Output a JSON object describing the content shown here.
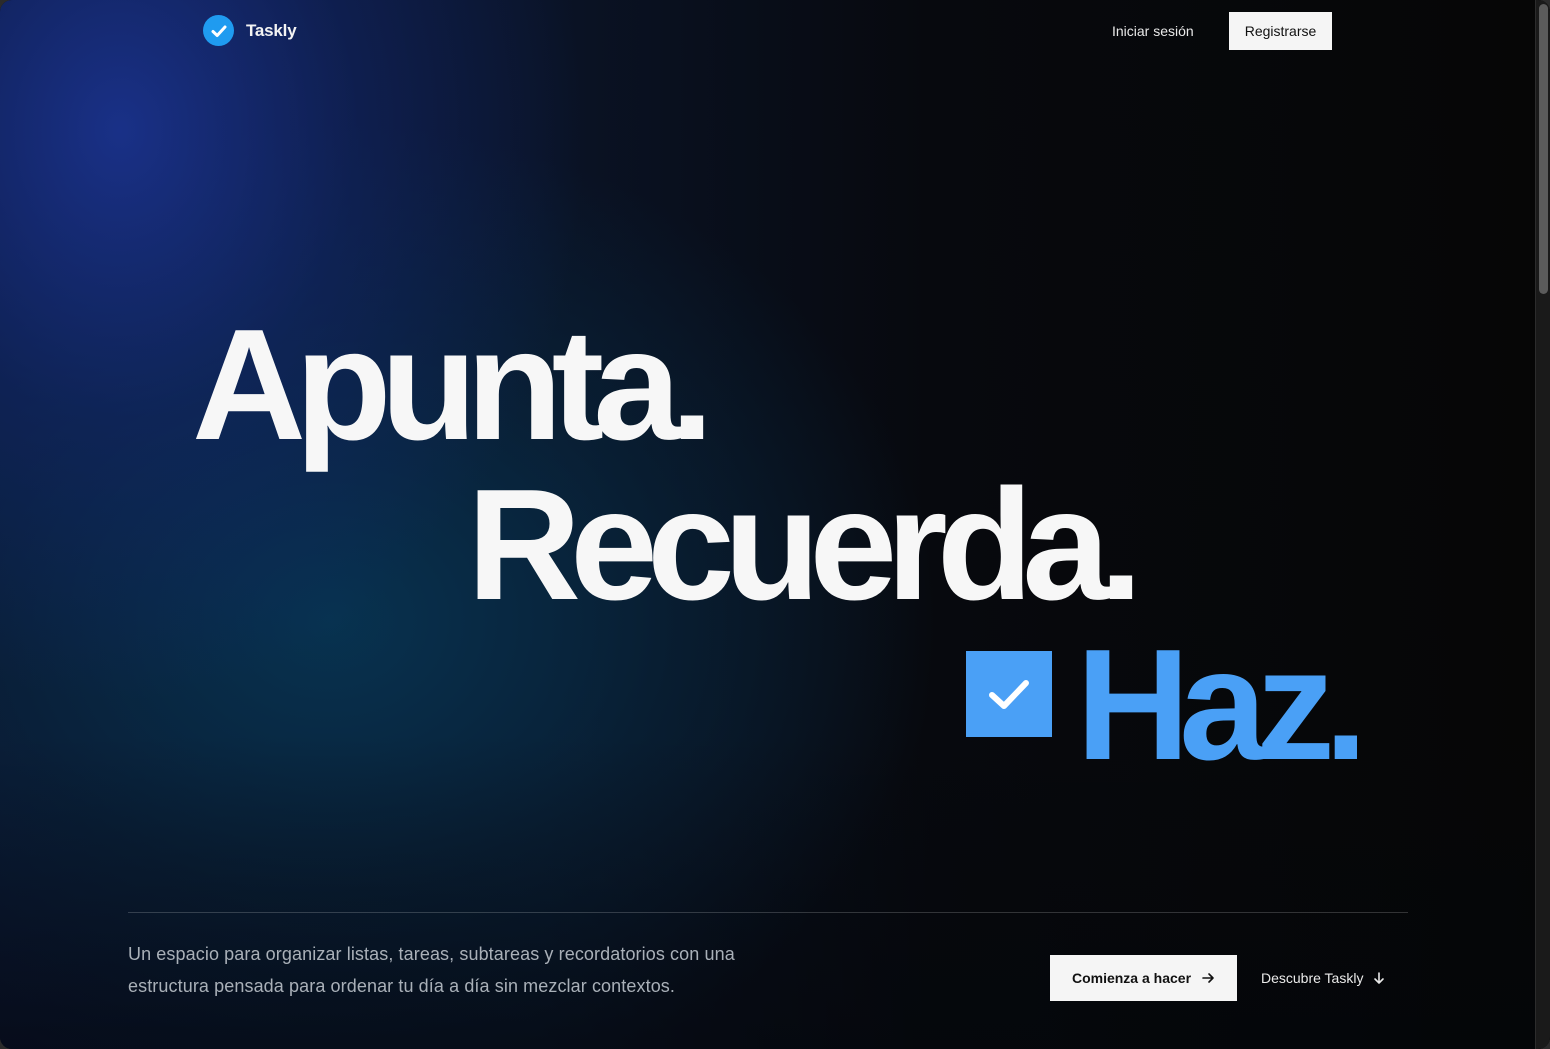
{
  "header": {
    "brand": "Taskly",
    "login_label": "Iniciar sesión",
    "signup_label": "Registrarse"
  },
  "hero": {
    "line1": "Apunta.",
    "line2": "Recuerda.",
    "line3": "Haz."
  },
  "footer": {
    "description_line1": "Un espacio para organizar listas, tareas, subtareas y recordatorios con una",
    "description_line2": "estructura pensada para ordenar tu día a día sin mezclar contextos.",
    "cta_label": "Comienza a hacer",
    "discover_label": "Descubre Taskly"
  },
  "icons": {
    "logo": "check-circle-icon",
    "hero_check": "checkbox-checked-icon",
    "cta_arrow": "arrow-right-icon",
    "discover_arrow": "arrow-down-icon"
  },
  "colors": {
    "accent": "#4aa0f6",
    "logo_blue": "#1f9bf0",
    "background": "#060606"
  }
}
